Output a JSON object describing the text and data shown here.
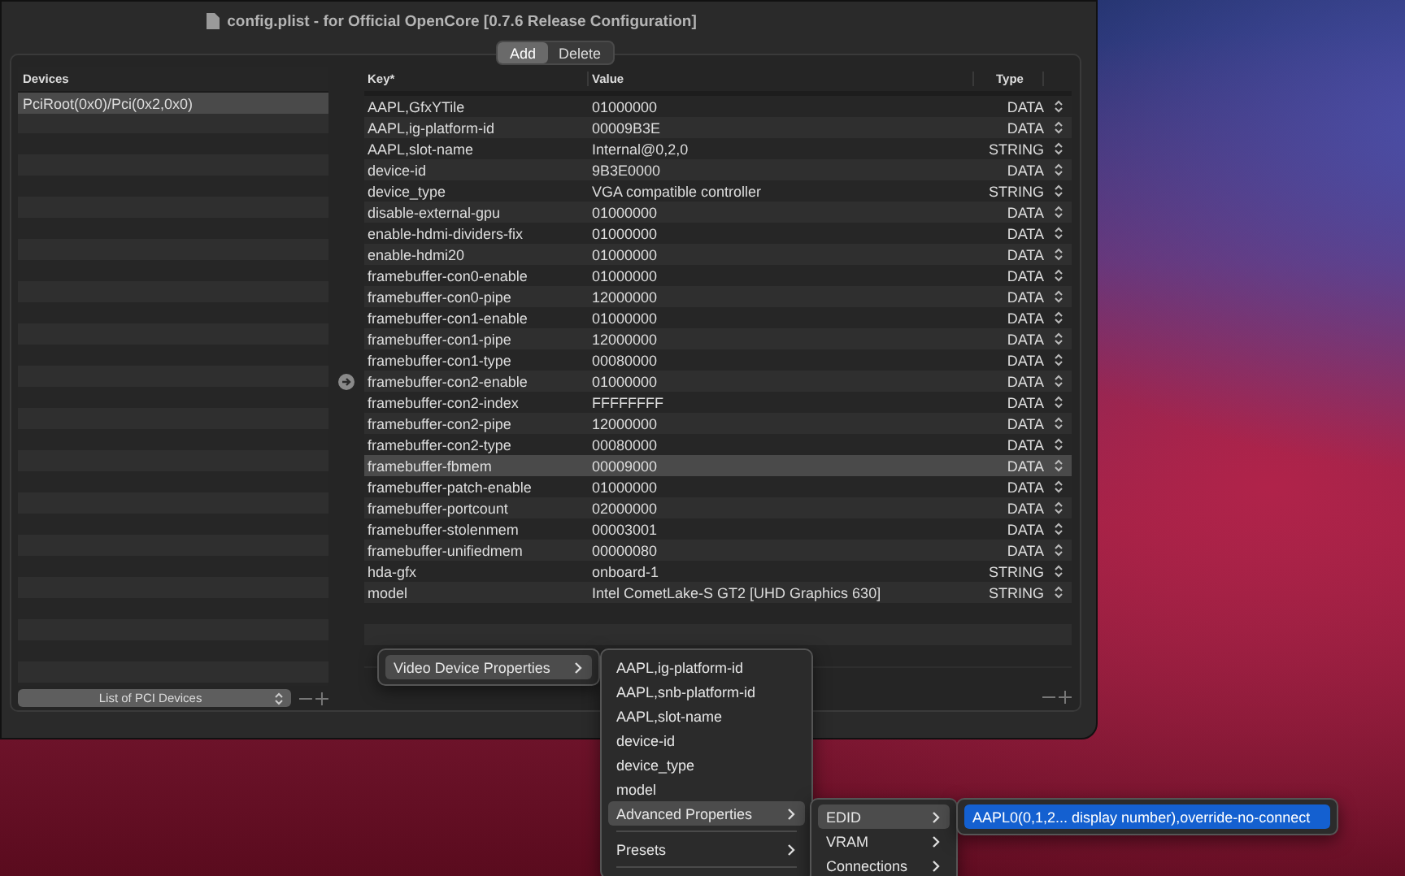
{
  "window": {
    "title": "config.plist - for Official OpenCore [0.7.6 Release Configuration]"
  },
  "segments": [
    {
      "label": "Add",
      "selected": true
    },
    {
      "label": "Delete",
      "selected": false
    }
  ],
  "devices": {
    "header": "Devices",
    "items": [
      {
        "label": "PciRoot(0x0)/Pci(0x2,0x0)",
        "selected": true
      }
    ],
    "popup": "List of PCI Devices"
  },
  "table": {
    "columns": [
      "Key*",
      "Value",
      "Type"
    ],
    "rows": [
      {
        "key": "AAPL,GfxYTile",
        "value": "01000000",
        "type": "DATA",
        "selected": false,
        "pointer": false
      },
      {
        "key": "AAPL,ig-platform-id",
        "value": "00009B3E",
        "type": "DATA",
        "selected": false,
        "pointer": false
      },
      {
        "key": "AAPL,slot-name",
        "value": "Internal@0,2,0",
        "type": "STRING",
        "selected": false,
        "pointer": false
      },
      {
        "key": "device-id",
        "value": "9B3E0000",
        "type": "DATA",
        "selected": false,
        "pointer": false
      },
      {
        "key": "device_type",
        "value": "VGA compatible controller",
        "type": "STRING",
        "selected": false,
        "pointer": false
      },
      {
        "key": "disable-external-gpu",
        "value": "01000000",
        "type": "DATA",
        "selected": false,
        "pointer": false
      },
      {
        "key": "enable-hdmi-dividers-fix",
        "value": "01000000",
        "type": "DATA",
        "selected": false,
        "pointer": false
      },
      {
        "key": "enable-hdmi20",
        "value": "01000000",
        "type": "DATA",
        "selected": false,
        "pointer": false
      },
      {
        "key": "framebuffer-con0-enable",
        "value": "01000000",
        "type": "DATA",
        "selected": false,
        "pointer": false
      },
      {
        "key": "framebuffer-con0-pipe",
        "value": "12000000",
        "type": "DATA",
        "selected": false,
        "pointer": false
      },
      {
        "key": "framebuffer-con1-enable",
        "value": "01000000",
        "type": "DATA",
        "selected": false,
        "pointer": false
      },
      {
        "key": "framebuffer-con1-pipe",
        "value": "12000000",
        "type": "DATA",
        "selected": false,
        "pointer": false
      },
      {
        "key": "framebuffer-con1-type",
        "value": "00080000",
        "type": "DATA",
        "selected": false,
        "pointer": false
      },
      {
        "key": "framebuffer-con2-enable",
        "value": "01000000",
        "type": "DATA",
        "selected": false,
        "pointer": true
      },
      {
        "key": "framebuffer-con2-index",
        "value": "FFFFFFFF",
        "type": "DATA",
        "selected": false,
        "pointer": false
      },
      {
        "key": "framebuffer-con2-pipe",
        "value": "12000000",
        "type": "DATA",
        "selected": false,
        "pointer": false
      },
      {
        "key": "framebuffer-con2-type",
        "value": "00080000",
        "type": "DATA",
        "selected": false,
        "pointer": false
      },
      {
        "key": "framebuffer-fbmem",
        "value": "00009000",
        "type": "DATA",
        "selected": true,
        "pointer": false
      },
      {
        "key": "framebuffer-patch-enable",
        "value": "01000000",
        "type": "DATA",
        "selected": false,
        "pointer": false
      },
      {
        "key": "framebuffer-portcount",
        "value": "02000000",
        "type": "DATA",
        "selected": false,
        "pointer": false
      },
      {
        "key": "framebuffer-stolenmem",
        "value": "00003001",
        "type": "DATA",
        "selected": false,
        "pointer": false
      },
      {
        "key": "framebuffer-unifiedmem",
        "value": "00000080",
        "type": "DATA",
        "selected": false,
        "pointer": false
      },
      {
        "key": "hda-gfx",
        "value": "onboard-1",
        "type": "STRING",
        "selected": false,
        "pointer": false
      },
      {
        "key": "model",
        "value": "Intel CometLake-S GT2 [UHD Graphics 630]",
        "type": "STRING",
        "selected": false,
        "pointer": false
      }
    ]
  },
  "menus": [
    {
      "items": [
        {
          "kind": "item",
          "label": "Video Device Properties",
          "submenu": true,
          "selected": true
        }
      ]
    },
    {
      "items": [
        {
          "kind": "item",
          "label": "AAPL,ig-platform-id",
          "submenu": false,
          "selected": false
        },
        {
          "kind": "item",
          "label": "AAPL,snb-platform-id",
          "submenu": false,
          "selected": false
        },
        {
          "kind": "item",
          "label": "AAPL,slot-name",
          "submenu": false,
          "selected": false
        },
        {
          "kind": "item",
          "label": "device-id",
          "submenu": false,
          "selected": false
        },
        {
          "kind": "item",
          "label": "device_type",
          "submenu": false,
          "selected": false
        },
        {
          "kind": "item",
          "label": "model",
          "submenu": false,
          "selected": false
        },
        {
          "kind": "item",
          "label": "Advanced Properties",
          "submenu": true,
          "selected": true
        },
        {
          "kind": "separator"
        },
        {
          "kind": "item",
          "label": "Presets",
          "submenu": true,
          "selected": false
        },
        {
          "kind": "separator"
        }
      ]
    },
    {
      "items": [
        {
          "kind": "item",
          "label": "EDID",
          "submenu": true,
          "selected": true
        },
        {
          "kind": "item",
          "label": "VRAM",
          "submenu": true,
          "selected": false
        },
        {
          "kind": "item",
          "label": "Connections",
          "submenu": true,
          "selected": false
        }
      ]
    },
    {
      "items": [
        {
          "kind": "item",
          "label": "AAPL0(0,1,2... display number),override-no-connect",
          "submenu": false,
          "selected": true,
          "accent": true
        }
      ]
    }
  ]
}
